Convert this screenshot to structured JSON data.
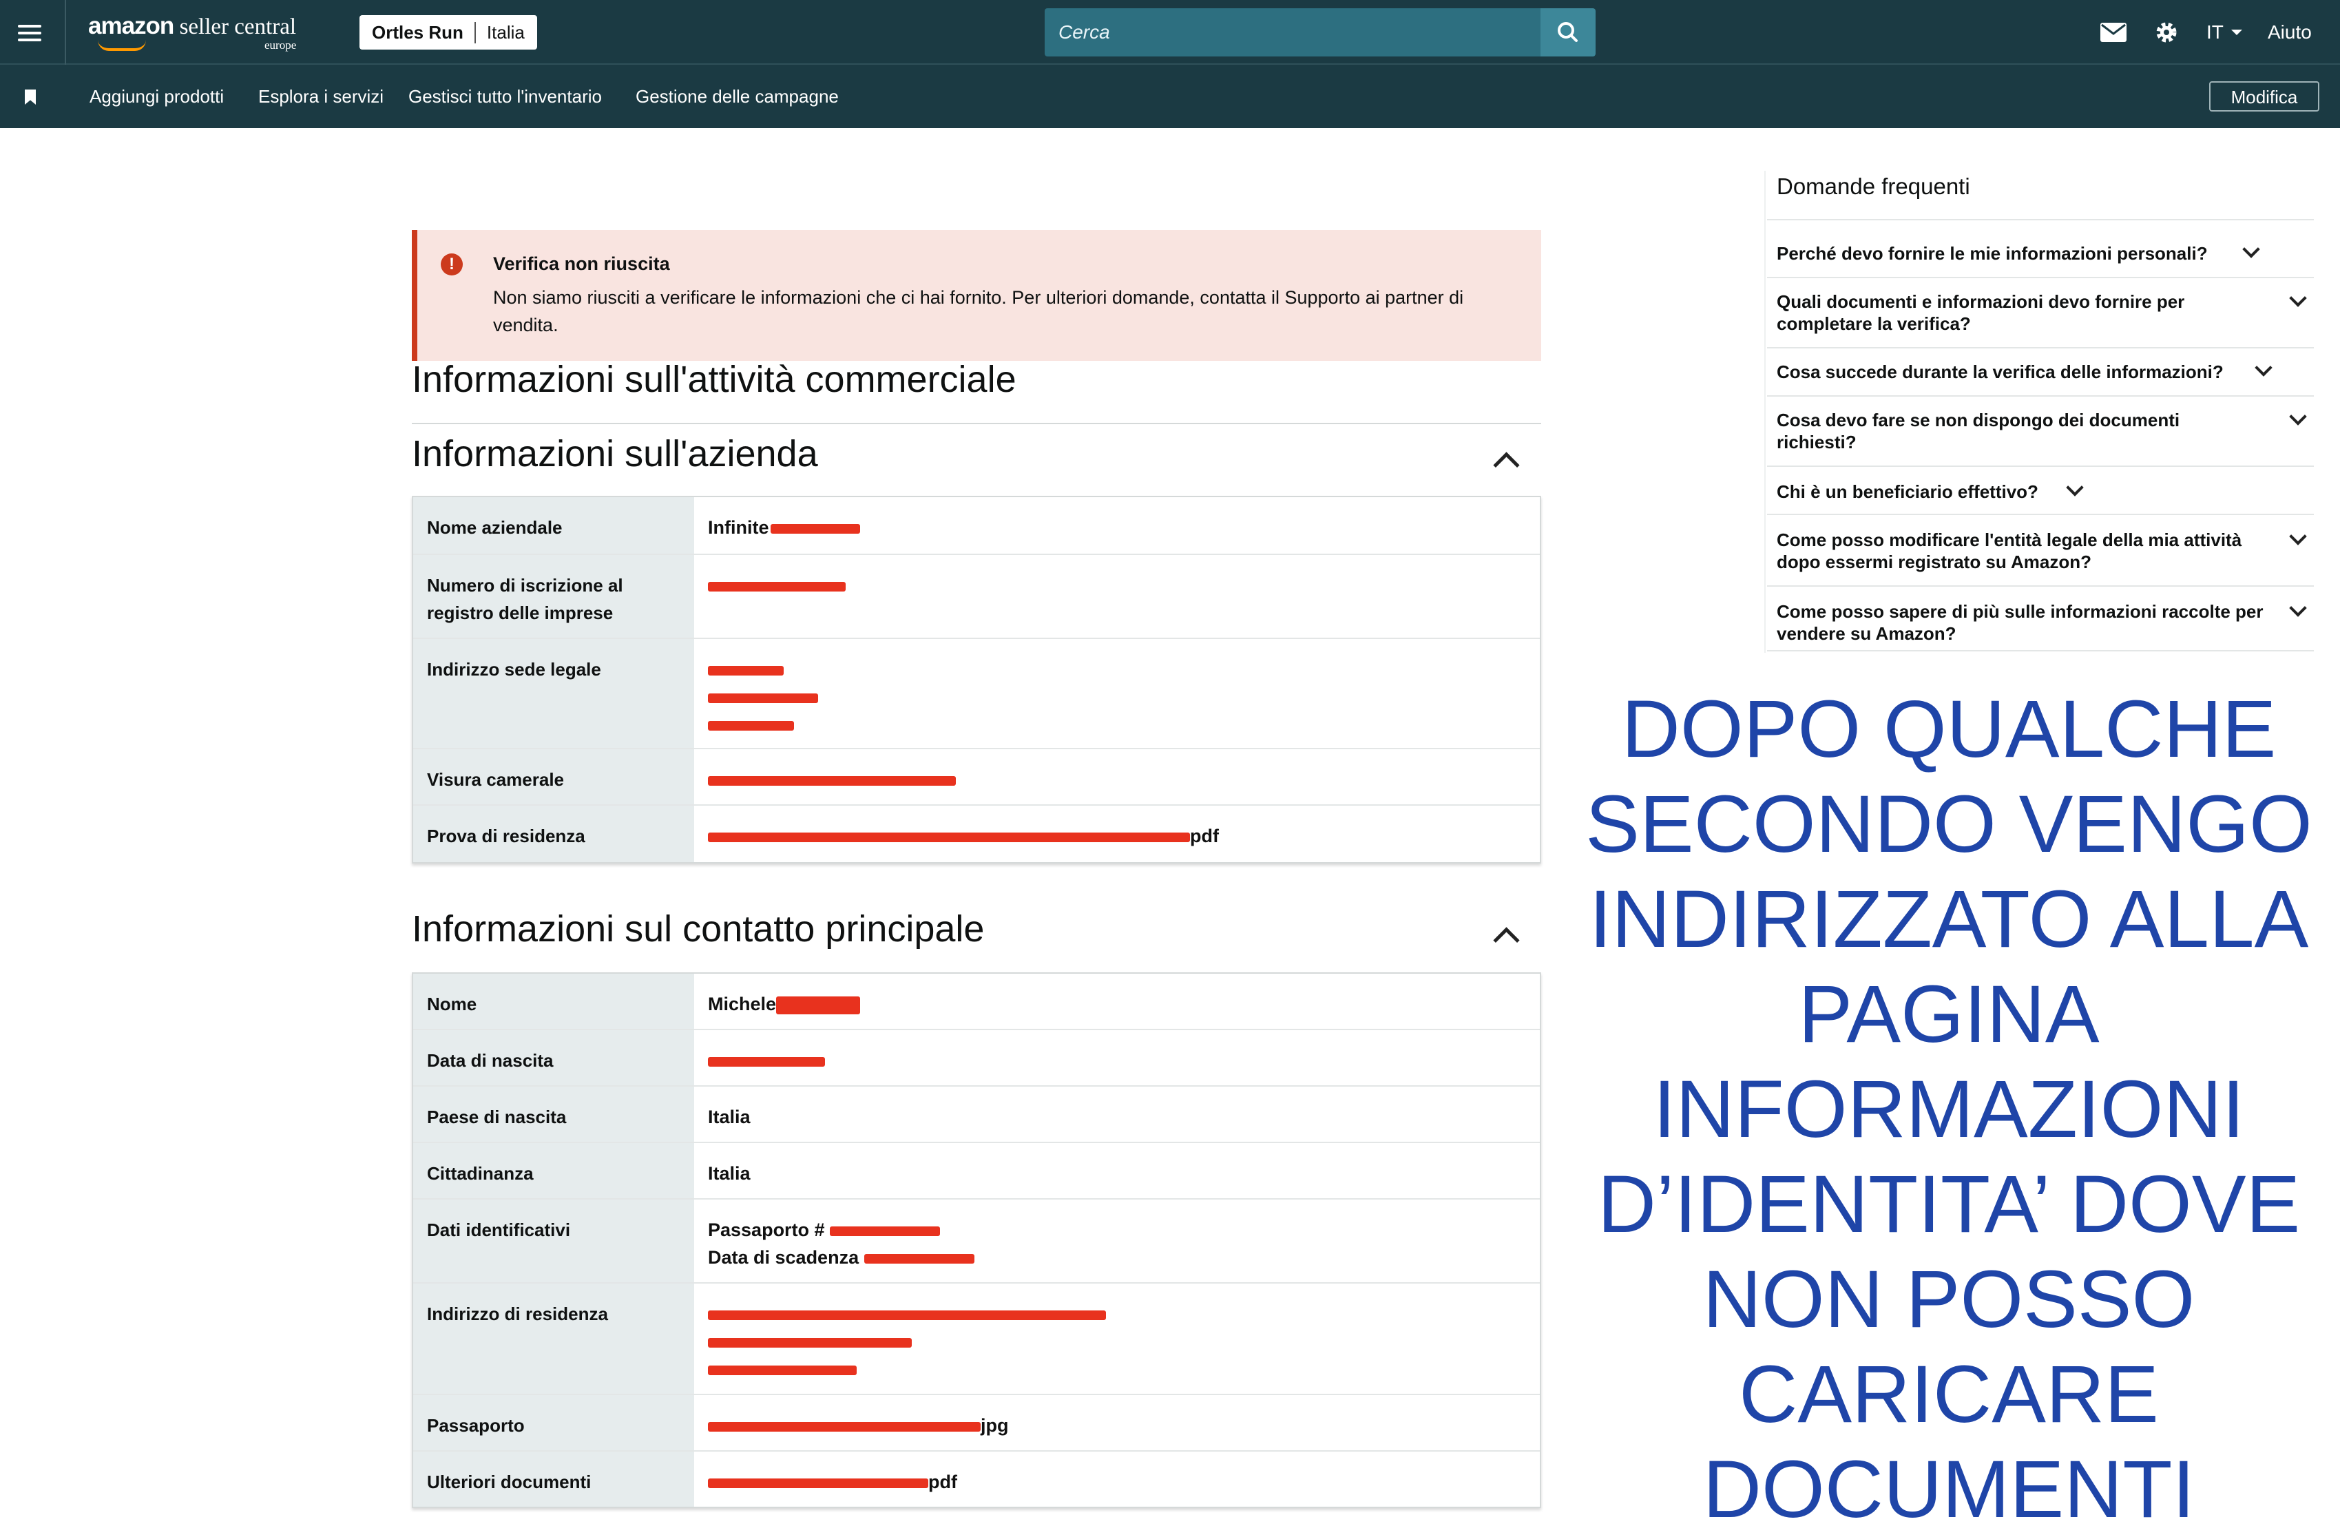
{
  "header": {
    "brand": "amazon",
    "brand_sub": " seller central",
    "region": "europe",
    "store_name": "Ortles Run",
    "store_country": "Italia",
    "search_placeholder": "Cerca",
    "language": "IT",
    "help": "Aiuto"
  },
  "nav": {
    "items": [
      "Aggiungi prodotti",
      "Esplora i servizi",
      "Gestisci tutto l'inventario",
      "Gestione delle campagne"
    ],
    "edit_label": "Modifica"
  },
  "alert": {
    "title": "Verifica non riuscita",
    "message": "Non siamo riusciti a verificare le informazioni che ci hai fornito. Per ulteriori domande, contatta il Supporto ai partner di vendita."
  },
  "main_title": "Informazioni sull'attività commerciale",
  "company": {
    "title": "Informazioni sull'azienda",
    "rows": [
      {
        "label": "Nome aziendale",
        "value": "Infinite"
      },
      {
        "label": "Numero di iscrizione al registro delle imprese",
        "value": ""
      },
      {
        "label": "Indirizzo sede legale",
        "value": ""
      },
      {
        "label": "Visura camerale",
        "value": ""
      },
      {
        "label": "Prova di residenza",
        "value": "pdf"
      }
    ]
  },
  "contact": {
    "title": "Informazioni sul contatto principale",
    "rows": [
      {
        "label": "Nome",
        "value": "Michele"
      },
      {
        "label": "Data di nascita",
        "value": ""
      },
      {
        "label": "Paese di nascita",
        "value": "Italia"
      },
      {
        "label": "Cittadinanza",
        "value": "Italia"
      },
      {
        "label": "Dati identificativi",
        "value": "Passaporto #",
        "value2": "Data di scadenza"
      },
      {
        "label": "Indirizzo di residenza",
        "value": ""
      },
      {
        "label": "Passaporto",
        "value": "jpg"
      },
      {
        "label": "Ulteriori documenti",
        "value": "pdf"
      }
    ]
  },
  "faq": {
    "title": "Domande frequenti",
    "items": [
      "Perché devo fornire le mie informazioni personali?",
      "Quali documenti e informazioni devo fornire per completare la verifica?",
      "Cosa succede durante la verifica delle informazioni?",
      "Cosa devo fare se non dispongo dei documenti richiesti?",
      "Chi è un beneficiario effettivo?",
      "Come posso modificare l'entità legale della mia attività dopo essermi registrato su Amazon?",
      "Come posso sapere di più sulle informazioni raccolte per vendere su Amazon?"
    ]
  },
  "annotation": "DOPO QUALCHE SECONDO VENGO INDIRIZZATO ALLA PAGINA INFORMAZIONI D’IDENTITA’ DOVE NON POSSO CARICARE DOCUMENTI",
  "colors": {
    "header_bg": "#1b3a43",
    "alert_bg": "#f9e4e0",
    "alert_accent": "#cc3a1d",
    "redaction": "#e8321e",
    "annotation": "#1f45a8"
  }
}
